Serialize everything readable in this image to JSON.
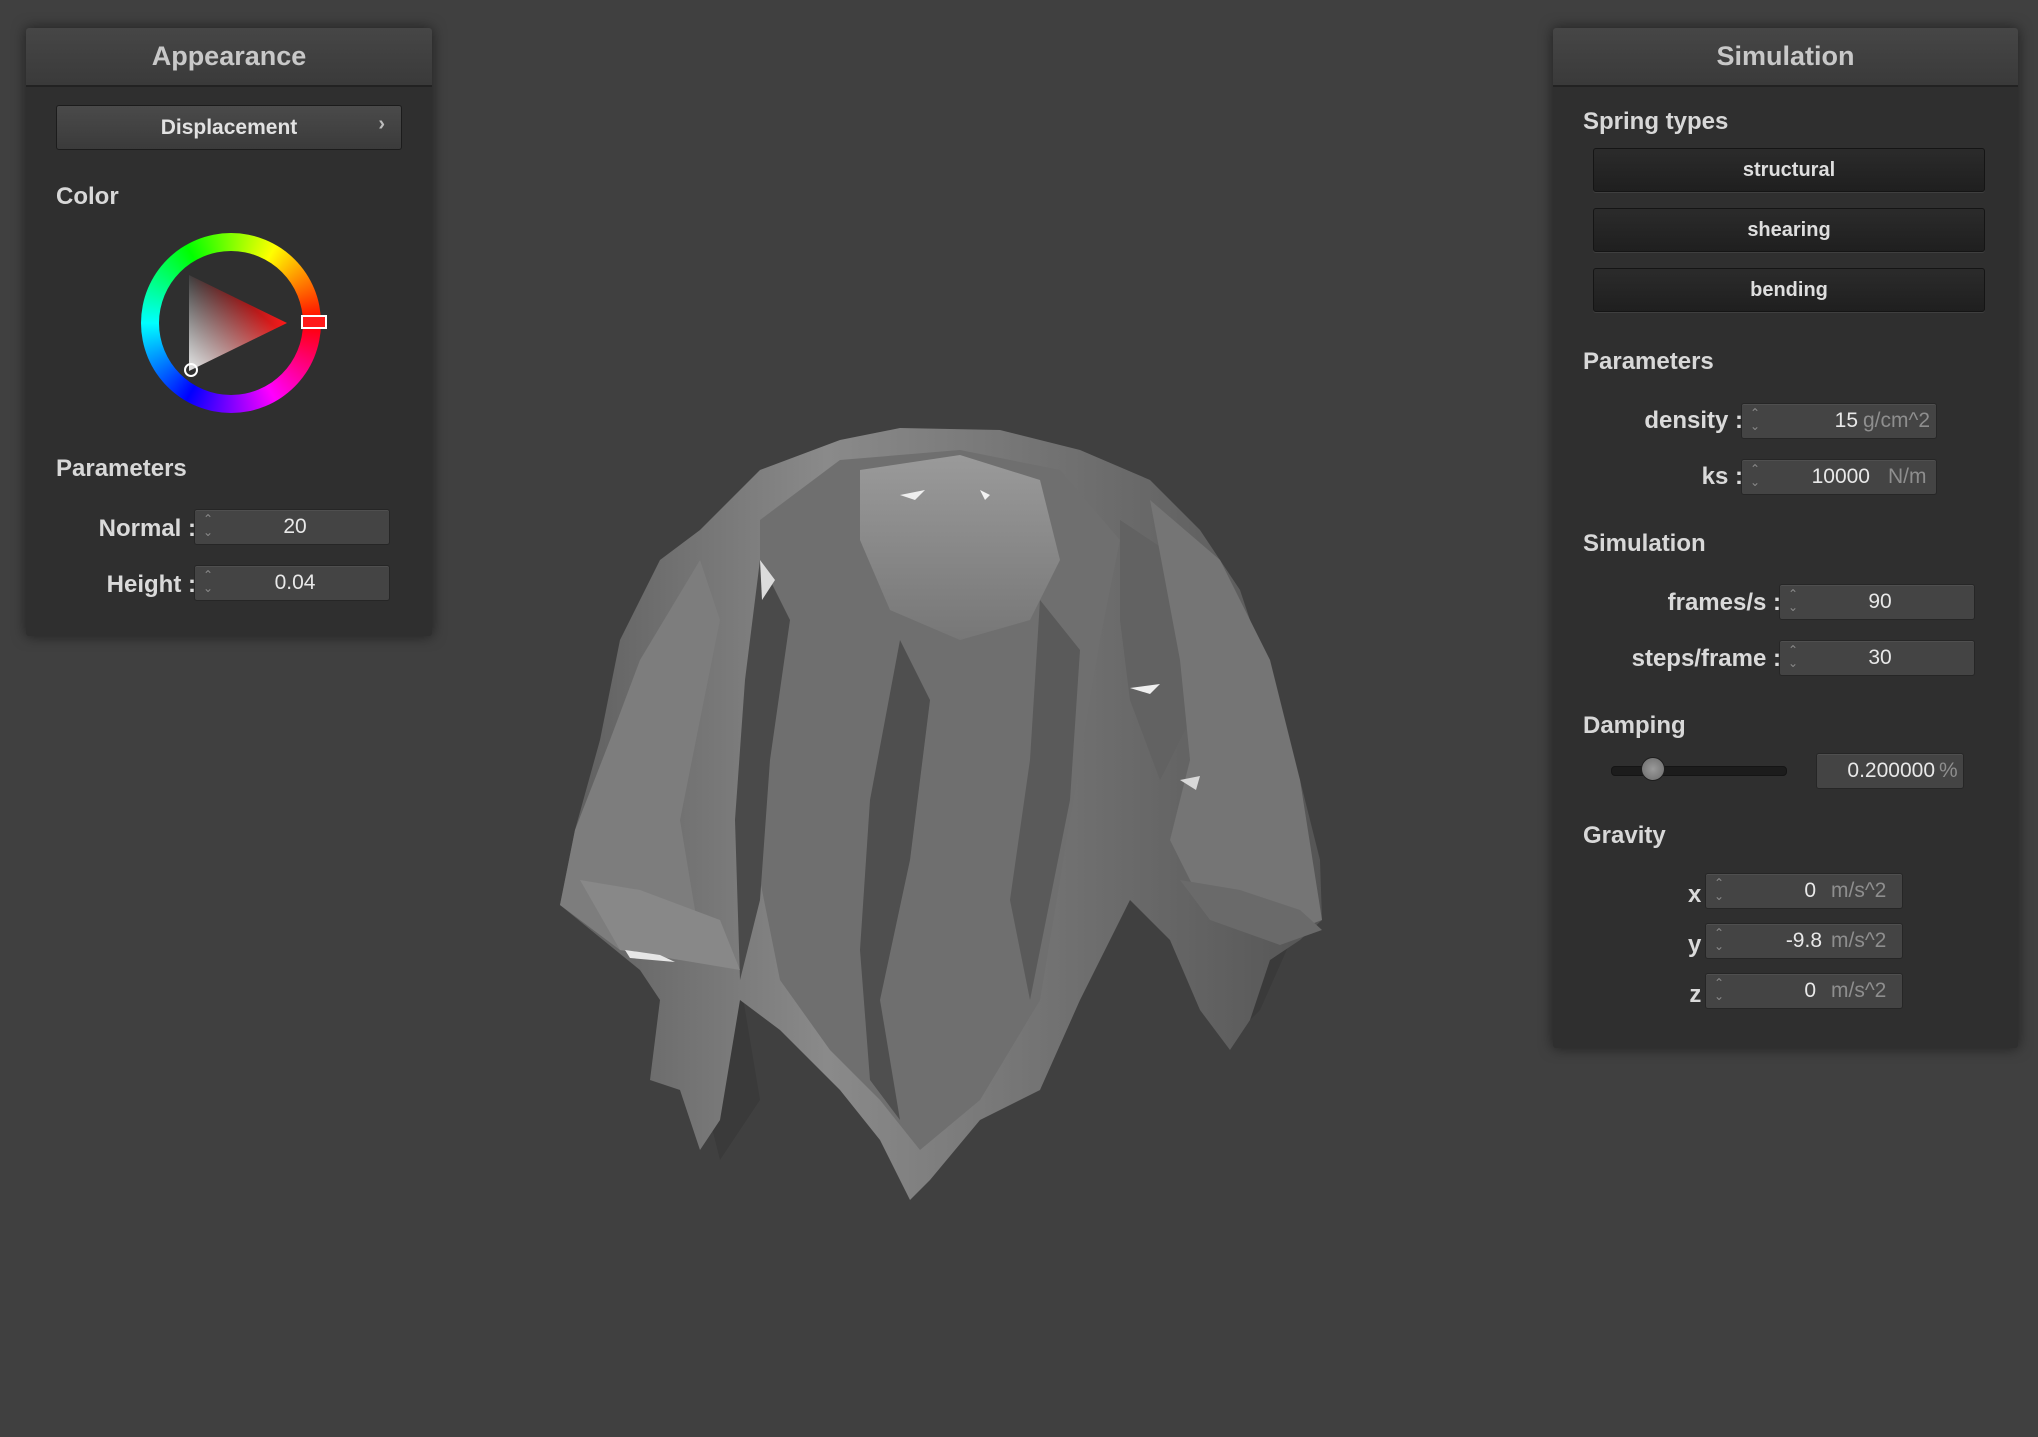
{
  "appearance": {
    "title": "Appearance",
    "map_button": "Displacement",
    "color_label": "Color",
    "params_label": "Parameters",
    "normal_label": "Normal :",
    "normal_value": "20",
    "height_label": "Height :",
    "height_value": "0.04",
    "color_hex": "#ff1a1a"
  },
  "simulation": {
    "title": "Simulation",
    "springs_label": "Spring types",
    "springs": [
      "structural",
      "shearing",
      "bending"
    ],
    "params_label": "Parameters",
    "density_label": "density :",
    "density_value": "15",
    "density_unit": "g/cm^2",
    "ks_label": "ks :",
    "ks_value": "10000",
    "ks_unit": "N/m",
    "sim_label": "Simulation",
    "fps_label": "frames/s :",
    "fps_value": "90",
    "steps_label": "steps/frame :",
    "steps_value": "30",
    "damping_label": "Damping",
    "damping_value": "0.200000",
    "damping_unit": "%",
    "damping_level": 0.2,
    "gravity_label": "Gravity",
    "gx_label": "x :",
    "gx_value": "0",
    "gx_unit": "m/s^2",
    "gy_label": "y :",
    "gy_value": "-9.8",
    "gy_unit": "m/s^2",
    "gz_label": "z :",
    "gz_value": "0",
    "gz_unit": "m/s^2"
  }
}
